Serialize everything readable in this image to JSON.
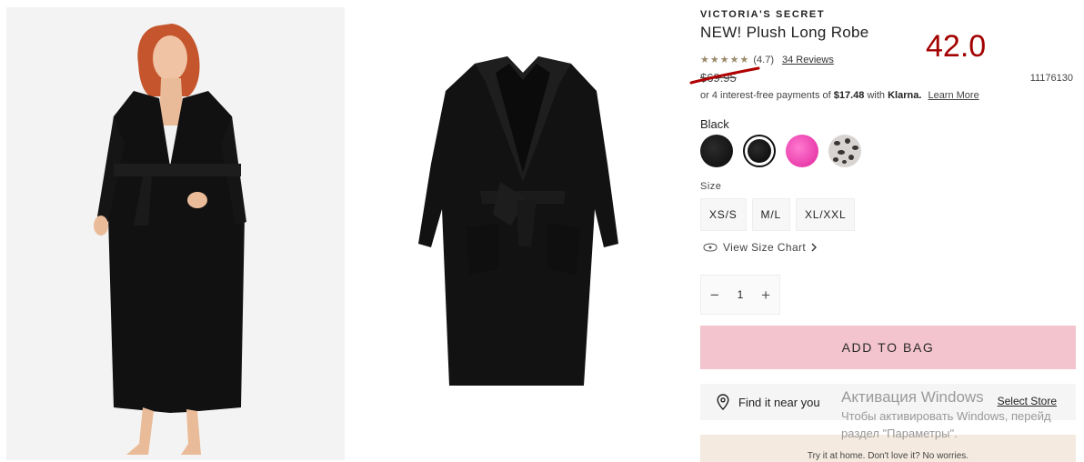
{
  "product": {
    "brand": "VICTORIA'S SECRET",
    "title": "NEW! Plush Long Robe",
    "sale_price": "42.0",
    "rating": "(4.7)",
    "reviews_link": "34 Reviews",
    "original_price": "$69.95",
    "sku": "11176130"
  },
  "klarna": {
    "text_prefix": "or 4 interest-free payments of",
    "amount": "$17.48",
    "with": "with",
    "brand": "Klarna.",
    "learn_more": "Learn More"
  },
  "color": {
    "selected_label": "Black",
    "swatches": [
      "black",
      "black-selected",
      "pink",
      "leopard"
    ]
  },
  "size": {
    "label": "Size",
    "options": [
      "XS/S",
      "M/L",
      "XL/XXL"
    ],
    "size_chart": "View Size Chart"
  },
  "quantity": {
    "value": "1"
  },
  "actions": {
    "add_to_bag": "ADD TO BAG",
    "find_near_you": "Find it near you",
    "select_store": "Select Store",
    "try_it_home": "Try it at home. Don't love it? No worries."
  },
  "watermark": {
    "line1": "Активация Windows",
    "line2": "Чтобы активировать Windows, перейд",
    "line3": "раздел \"Параметры\"."
  },
  "colors": {
    "add_to_bag_bg": "#f3c4cd",
    "sale_price": "#a30000",
    "strike_mark": "#b00000"
  },
  "icons": [
    "star-icon",
    "ruler-icon",
    "chevron-right-icon",
    "minus-icon",
    "plus-icon",
    "location-pin-icon"
  ]
}
